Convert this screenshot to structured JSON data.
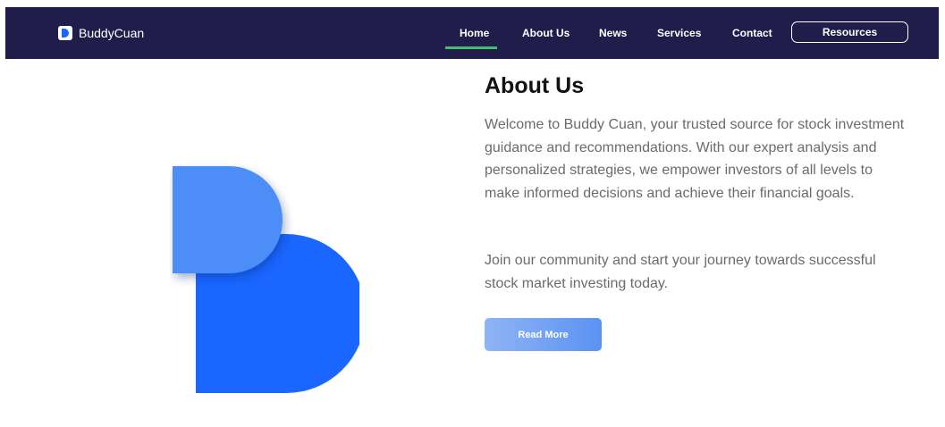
{
  "brand": {
    "name": "BuddyCuan",
    "logo_icon": "buddycuan-logo-icon"
  },
  "nav": {
    "items": [
      {
        "label": "Home",
        "active": true
      },
      {
        "label": "About Us",
        "active": false
      },
      {
        "label": "News",
        "active": false
      },
      {
        "label": "Services",
        "active": false
      },
      {
        "label": "Contact",
        "active": false
      }
    ],
    "resources_label": "Resources"
  },
  "about": {
    "title": "About Us",
    "paragraph1": "Welcome to Buddy Cuan, your trusted source for stock investment guidance and recommendations. With our expert analysis and personalized strategies, we empower investors of all levels to make informed decisions and achieve their financial goals.",
    "paragraph2": "Join our community and start your journey towards successful stock market investing today.",
    "cta_label": "Read More"
  },
  "colors": {
    "navbar_bg": "#211d4b",
    "active_underline": "#3fbf6f",
    "logo_dark_blue": "#1a66ff",
    "logo_light_blue": "#4d8df7"
  }
}
